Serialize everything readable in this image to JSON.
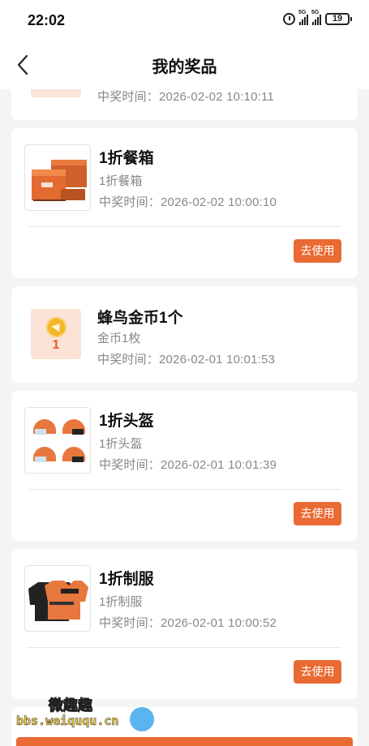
{
  "status_bar": {
    "time": "22:02",
    "signal_label_1": "5G",
    "signal_label_2": "5G",
    "battery": "19"
  },
  "header": {
    "title": "我的奖品"
  },
  "prizes": [
    {
      "name": "",
      "desc": "",
      "time": "中奖时间：2026-02-02 10:10:11",
      "thumb": "partial-image"
    },
    {
      "name": "1折餐箱",
      "desc": "1折餐箱",
      "time": "中奖时间：2026-02-02 10:00:10",
      "action": "去使用",
      "thumb": "delivery-box-image"
    },
    {
      "name": "蜂鸟金币1个",
      "desc": "金币1枚",
      "time": "中奖时间：2026-02-01 10:01:53",
      "thumb": "gold-coin-icon",
      "count": "1"
    },
    {
      "name": "1折头盔",
      "desc": "1折头盔",
      "time": "中奖时间：2026-02-01 10:01:39",
      "action": "去使用",
      "thumb": "helmet-image"
    },
    {
      "name": "1折制服",
      "desc": "1折制服",
      "time": "中奖时间：2026-02-01 10:00:52",
      "action": "去使用",
      "thumb": "uniform-image"
    }
  ],
  "watermark": {
    "text": "微趣趣",
    "url": "bbs.weiququ.cn"
  },
  "colors": {
    "accent": "#ea6a33",
    "background": "#f4f4f4",
    "coin_bg": "#fbe3d7"
  }
}
